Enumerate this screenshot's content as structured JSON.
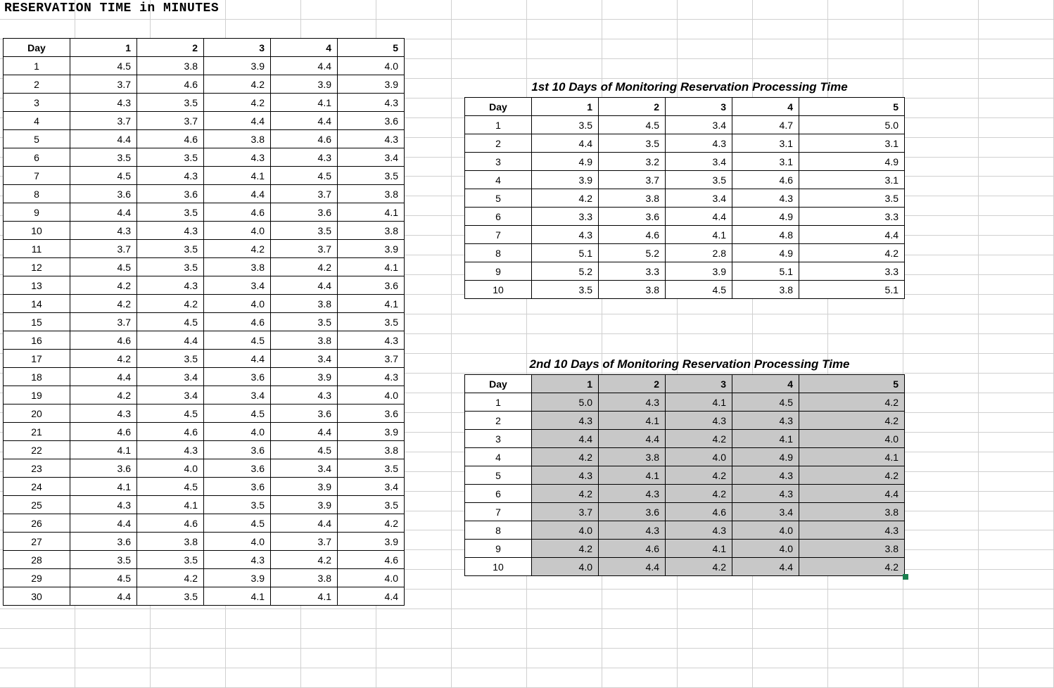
{
  "title": "RESERVATION TIME in MINUTES",
  "mainTable": {
    "header": [
      "Day",
      "1",
      "2",
      "3",
      "4",
      "5"
    ],
    "rows": [
      [
        "1",
        "4.5",
        "3.8",
        "3.9",
        "4.4",
        "4.0"
      ],
      [
        "2",
        "3.7",
        "4.6",
        "4.2",
        "3.9",
        "3.9"
      ],
      [
        "3",
        "4.3",
        "3.5",
        "4.2",
        "4.1",
        "4.3"
      ],
      [
        "4",
        "3.7",
        "3.7",
        "4.4",
        "4.4",
        "3.6"
      ],
      [
        "5",
        "4.4",
        "4.6",
        "3.8",
        "4.6",
        "4.3"
      ],
      [
        "6",
        "3.5",
        "3.5",
        "4.3",
        "4.3",
        "3.4"
      ],
      [
        "7",
        "4.5",
        "4.3",
        "4.1",
        "4.5",
        "3.5"
      ],
      [
        "8",
        "3.6",
        "3.6",
        "4.4",
        "3.7",
        "3.8"
      ],
      [
        "9",
        "4.4",
        "3.5",
        "4.6",
        "3.6",
        "4.1"
      ],
      [
        "10",
        "4.3",
        "4.3",
        "4.0",
        "3.5",
        "3.8"
      ],
      [
        "11",
        "3.7",
        "3.5",
        "4.2",
        "3.7",
        "3.9"
      ],
      [
        "12",
        "4.5",
        "3.5",
        "3.8",
        "4.2",
        "4.1"
      ],
      [
        "13",
        "4.2",
        "4.3",
        "3.4",
        "4.4",
        "3.6"
      ],
      [
        "14",
        "4.2",
        "4.2",
        "4.0",
        "3.8",
        "4.1"
      ],
      [
        "15",
        "3.7",
        "4.5",
        "4.6",
        "3.5",
        "3.5"
      ],
      [
        "16",
        "4.6",
        "4.4",
        "4.5",
        "3.8",
        "4.3"
      ],
      [
        "17",
        "4.2",
        "3.5",
        "4.4",
        "3.4",
        "3.7"
      ],
      [
        "18",
        "4.4",
        "3.4",
        "3.6",
        "3.9",
        "4.3"
      ],
      [
        "19",
        "4.2",
        "3.4",
        "3.4",
        "4.3",
        "4.0"
      ],
      [
        "20",
        "4.3",
        "4.5",
        "4.5",
        "3.6",
        "3.6"
      ],
      [
        "21",
        "4.6",
        "4.6",
        "4.0",
        "4.4",
        "3.9"
      ],
      [
        "22",
        "4.1",
        "4.3",
        "3.6",
        "4.5",
        "3.8"
      ],
      [
        "23",
        "3.6",
        "4.0",
        "3.6",
        "3.4",
        "3.5"
      ],
      [
        "24",
        "4.1",
        "4.5",
        "3.6",
        "3.9",
        "3.4"
      ],
      [
        "25",
        "4.3",
        "4.1",
        "3.5",
        "3.9",
        "3.5"
      ],
      [
        "26",
        "4.4",
        "4.6",
        "4.5",
        "4.4",
        "4.2"
      ],
      [
        "27",
        "3.6",
        "3.8",
        "4.0",
        "3.7",
        "3.9"
      ],
      [
        "28",
        "3.5",
        "3.5",
        "4.3",
        "4.2",
        "4.6"
      ],
      [
        "29",
        "4.5",
        "4.2",
        "3.9",
        "3.8",
        "4.0"
      ],
      [
        "30",
        "4.4",
        "3.5",
        "4.1",
        "4.1",
        "4.4"
      ]
    ]
  },
  "sub1": {
    "title": "1st 10 Days of Monitoring Reservation Processing Time",
    "header": [
      "Day",
      "1",
      "2",
      "3",
      "4",
      "5"
    ],
    "rows": [
      [
        "1",
        "3.5",
        "4.5",
        "3.4",
        "4.7",
        "5.0"
      ],
      [
        "2",
        "4.4",
        "3.5",
        "4.3",
        "3.1",
        "3.1"
      ],
      [
        "3",
        "4.9",
        "3.2",
        "3.4",
        "3.1",
        "4.9"
      ],
      [
        "4",
        "3.9",
        "3.7",
        "3.5",
        "4.6",
        "3.1"
      ],
      [
        "5",
        "4.2",
        "3.8",
        "3.4",
        "4.3",
        "3.5"
      ],
      [
        "6",
        "3.3",
        "3.6",
        "4.4",
        "4.9",
        "3.3"
      ],
      [
        "7",
        "4.3",
        "4.6",
        "4.1",
        "4.8",
        "4.4"
      ],
      [
        "8",
        "5.1",
        "5.2",
        "2.8",
        "4.9",
        "4.2"
      ],
      [
        "9",
        "5.2",
        "3.3",
        "3.9",
        "5.1",
        "3.3"
      ],
      [
        "10",
        "3.5",
        "3.8",
        "4.5",
        "3.8",
        "5.1"
      ]
    ]
  },
  "sub2": {
    "title": "2nd 10 Days of Monitoring Reservation Processing Time",
    "header": [
      "Day",
      "1",
      "2",
      "3",
      "4",
      "5"
    ],
    "rows": [
      [
        "1",
        "5.0",
        "4.3",
        "4.1",
        "4.5",
        "4.2"
      ],
      [
        "2",
        "4.3",
        "4.1",
        "4.3",
        "4.3",
        "4.2"
      ],
      [
        "3",
        "4.4",
        "4.4",
        "4.2",
        "4.1",
        "4.0"
      ],
      [
        "4",
        "4.2",
        "3.8",
        "4.0",
        "4.9",
        "4.1"
      ],
      [
        "5",
        "4.3",
        "4.1",
        "4.2",
        "4.3",
        "4.2"
      ],
      [
        "6",
        "4.2",
        "4.3",
        "4.2",
        "4.3",
        "4.4"
      ],
      [
        "7",
        "3.7",
        "3.6",
        "4.6",
        "3.4",
        "3.8"
      ],
      [
        "8",
        "4.0",
        "4.3",
        "4.3",
        "4.0",
        "4.3"
      ],
      [
        "9",
        "4.2",
        "4.6",
        "4.1",
        "4.0",
        "3.8"
      ],
      [
        "10",
        "4.0",
        "4.4",
        "4.2",
        "4.4",
        "4.2"
      ]
    ]
  }
}
